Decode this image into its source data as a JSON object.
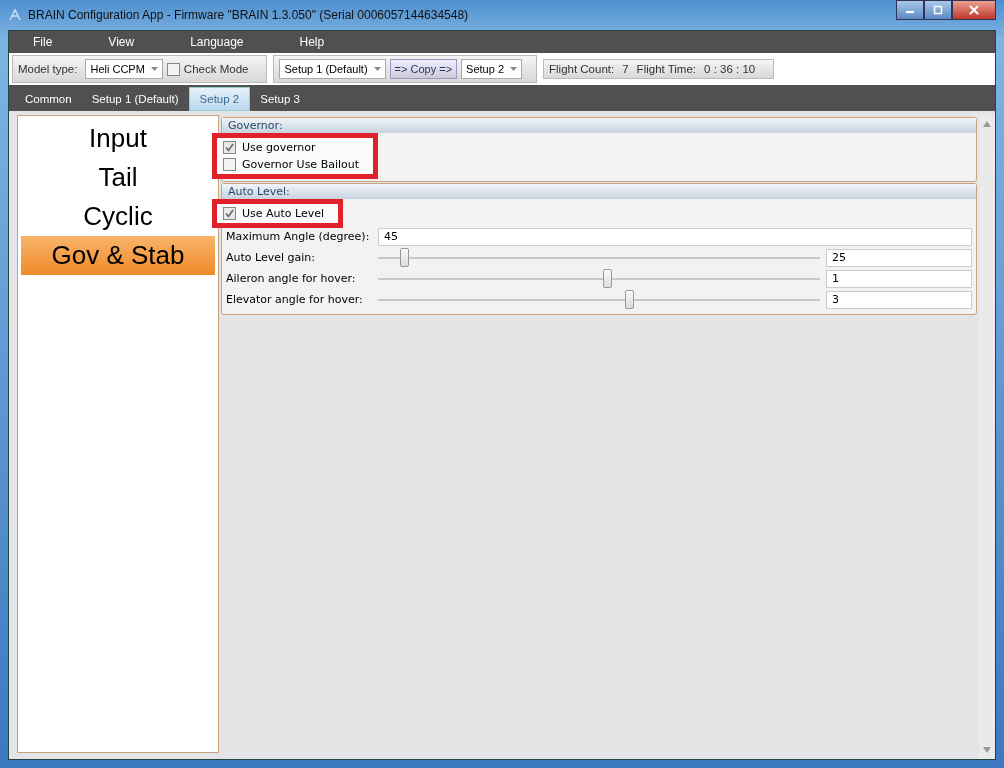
{
  "window": {
    "title": "BRAIN Configuration App - Firmware \"BRAIN 1.3.050\" (Serial 0006057144634548)"
  },
  "menu": [
    "File",
    "View",
    "Language",
    "Help"
  ],
  "toolbar": {
    "model_type_label": "Model type:",
    "model_type": "Heli CCPM",
    "check_mode": {
      "label": "Check Mode",
      "checked": false
    },
    "copy_from": "Setup 1 (Default)",
    "copy_button": "=> Copy =>",
    "copy_to": "Setup 2",
    "flight_count_label": "Flight Count:",
    "flight_count": "7",
    "flight_time_label": "Flight Time:",
    "flight_time": "0 : 36 : 10"
  },
  "tabs": [
    {
      "label": "Common",
      "selected": false
    },
    {
      "label": "Setup 1 (Default)",
      "selected": false
    },
    {
      "label": "Setup 2",
      "selected": true
    },
    {
      "label": "Setup 3",
      "selected": false
    }
  ],
  "sidebar": {
    "items": [
      {
        "label": "Input",
        "selected": false
      },
      {
        "label": "Tail",
        "selected": false
      },
      {
        "label": "Cyclic",
        "selected": false
      },
      {
        "label": "Gov & Stab",
        "selected": true
      }
    ]
  },
  "sections": [
    {
      "title": "Governor:",
      "highlighted": true,
      "checkboxes": [
        {
          "label": "Use governor",
          "checked": true
        },
        {
          "label": "Governor Use Bailout",
          "checked": false
        }
      ]
    },
    {
      "title": "Auto Level:",
      "highlighted": true,
      "checkboxes": [
        {
          "label": "Use Auto Level",
          "checked": true
        }
      ],
      "fields": [
        {
          "kind": "text",
          "label": "Maximum Angle (degree):",
          "value": "45"
        },
        {
          "kind": "slider",
          "label": "Auto Level gain:",
          "level": 0.06,
          "value": "25"
        },
        {
          "kind": "slider",
          "label": "Aileron angle for hover:",
          "level": 0.52,
          "value": "1"
        },
        {
          "kind": "slider",
          "label": "Elevator angle for hover:",
          "level": 0.57,
          "value": "3"
        }
      ]
    }
  ]
}
